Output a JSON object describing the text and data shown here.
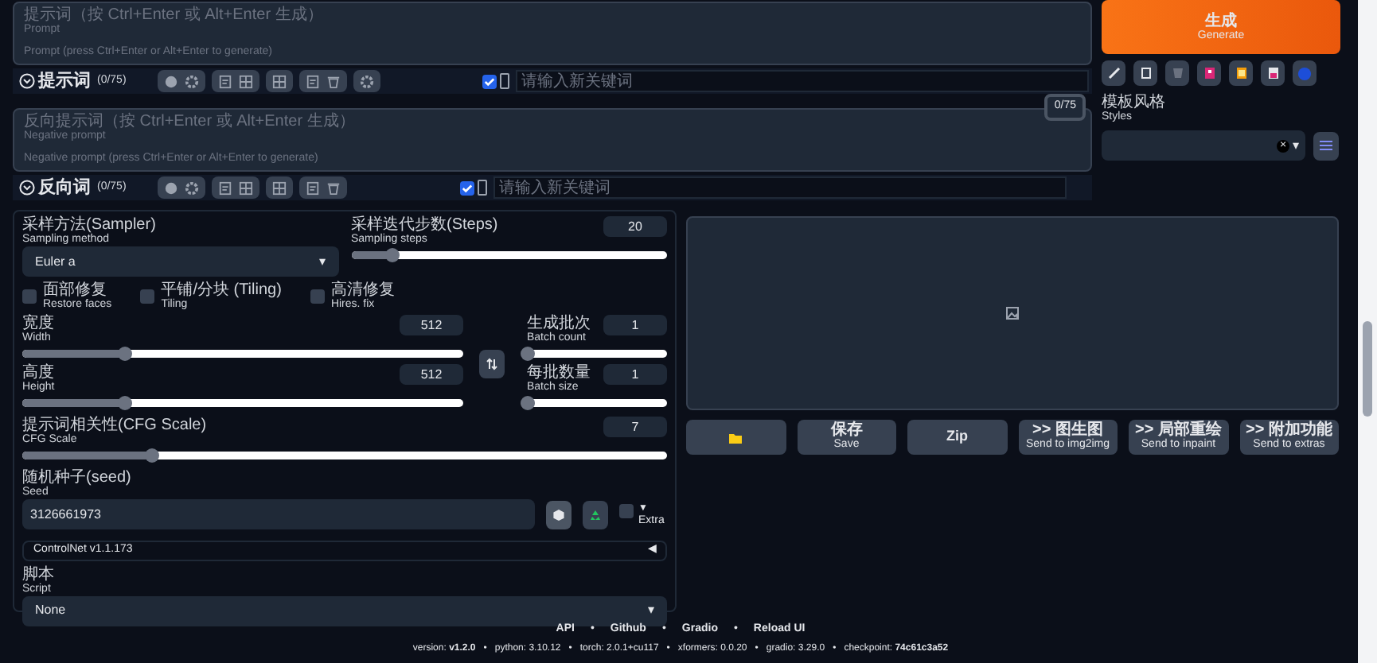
{
  "prompts": [
    {
      "kind": "positive",
      "hint_cn": "提示词（按 Ctrl+Enter 或 Alt+Enter 生成）",
      "hint_en": "Prompt",
      "placeholder": "Prompt (press Ctrl+Enter or Alt+Enter to generate)",
      "title": "提示词",
      "count": "(0/75)",
      "keyword_checked": true,
      "keyword_placeholder": "请输入新关键词"
    },
    {
      "kind": "negative",
      "hint_cn": "反向提示词（按 Ctrl+Enter 或 Alt+Enter 生成）",
      "hint_en": "Negative prompt",
      "placeholder": "Negative prompt (press Ctrl+Enter or Alt+Enter to generate)",
      "title": "反向词",
      "count": "(0/75)",
      "counter": "0/75",
      "keyword_checked": true,
      "keyword_placeholder": "请输入新关键词"
    }
  ],
  "generate": {
    "label_cn": "生成",
    "label_en": "Generate"
  },
  "styles": {
    "label_cn": "模板风格",
    "label_en": "Styles",
    "clear": "×",
    "caret": "▾"
  },
  "sampler": {
    "label_cn": "采样方法(Sampler)",
    "label_en": "Sampling method",
    "value": "Euler a",
    "caret": "▾"
  },
  "steps": {
    "label_cn": "采样迭代步数(Steps)",
    "label_en": "Sampling steps",
    "value": "20",
    "level": 0.13
  },
  "options": [
    {
      "label_cn": "面部修复",
      "label_en": "Restore faces",
      "checked": false
    },
    {
      "label_cn": "平铺/分块 (Tiling)",
      "label_en": "Tiling",
      "checked": false
    },
    {
      "label_cn": "高清修复",
      "label_en": "Hires. fix",
      "checked": false
    }
  ],
  "size": [
    {
      "label_cn": "宽度",
      "label_en": "Width",
      "value": "512",
      "level": 0.23
    },
    {
      "label_cn": "高度",
      "label_en": "Height",
      "value": "512",
      "level": 0.23
    }
  ],
  "batch": [
    {
      "label_cn": "生成批次",
      "label_en": "Batch count",
      "value": "1",
      "level": 0.0
    },
    {
      "label_cn": "每批数量",
      "label_en": "Batch size",
      "value": "1",
      "level": 0.0
    }
  ],
  "cfg": {
    "label_cn": "提示词相关性(CFG Scale)",
    "label_en": "CFG Scale",
    "value": "7",
    "level": 0.2
  },
  "seed": {
    "label_cn": "随机种子(seed)",
    "label_en": "Seed",
    "value": "3126661973",
    "extra_checked": false,
    "extra_arrow": "▼",
    "extra_label": "Extra"
  },
  "controlnet": {
    "label": "ControlNet v1.1.173",
    "arrow": "◀"
  },
  "script": {
    "label_cn": "脚本",
    "label_en": "Script",
    "value": "None",
    "caret": "▾"
  },
  "output_buttons": [
    {
      "kind": "folder"
    },
    {
      "kind": "text",
      "label_cn": "保存",
      "label_en": "Save"
    },
    {
      "kind": "text",
      "label_en": "Zip"
    },
    {
      "kind": "text",
      "label_cn": ">> 图生图",
      "label_en": "Send to img2img"
    },
    {
      "kind": "text",
      "label_cn": ">> 局部重绘",
      "label_en": "Send to inpaint"
    },
    {
      "kind": "text",
      "label_cn": ">> 附加功能",
      "label_en": "Send to extras"
    }
  ],
  "footer": {
    "separator": "•",
    "links": [
      "API",
      "Github",
      "Gradio",
      "Reload UI"
    ],
    "versions": [
      "version: **v1.2.0**",
      "python: 3.10.12",
      "torch: 2.0.1+cu117",
      "xformers: 0.0.20",
      "gradio: 3.29.0",
      "checkpoint: **74c61c3a52**"
    ]
  }
}
